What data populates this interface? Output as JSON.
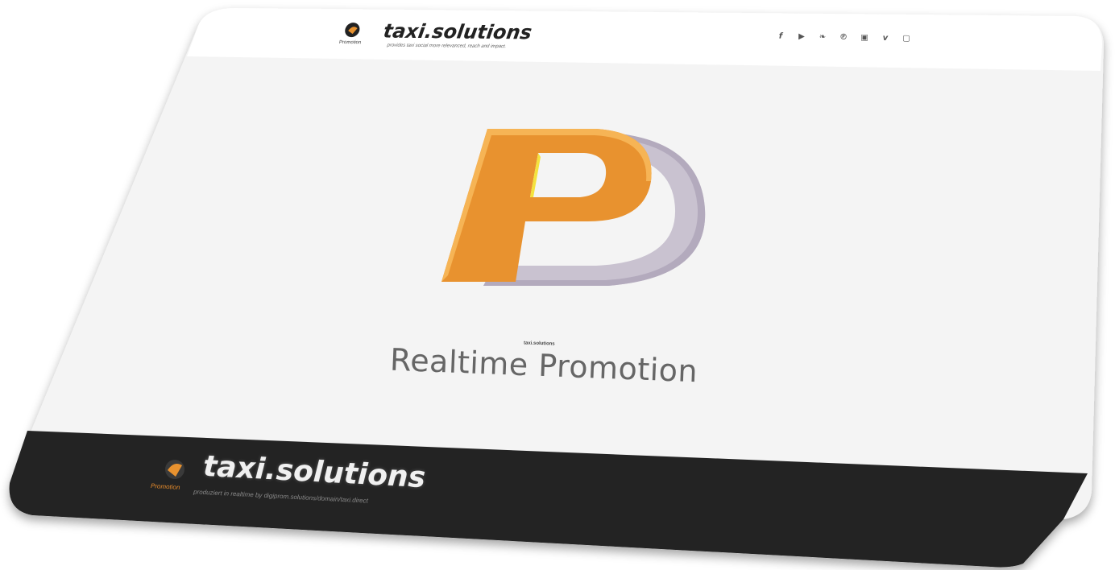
{
  "header": {
    "brand_title": "taxi.solutions",
    "brand_badge": "Promotion",
    "brand_tagline": "provides taxi social more relevanced, reach and impact.",
    "social_icons": [
      {
        "name": "facebook-icon",
        "glyph": "f"
      },
      {
        "name": "youtube-icon",
        "glyph": "▶"
      },
      {
        "name": "twitter-icon",
        "glyph": "❧"
      },
      {
        "name": "pinterest-icon",
        "glyph": "℗"
      },
      {
        "name": "stumbleupon-icon",
        "glyph": "▣"
      },
      {
        "name": "vimeo-icon",
        "glyph": "v"
      },
      {
        "name": "twitch-icon",
        "glyph": "▢"
      }
    ]
  },
  "hero": {
    "small_label": "taxi.solutions",
    "title": "Realtime Promotion"
  },
  "footer": {
    "brand_badge": "Promotion",
    "brand_title": "taxi.solutions",
    "tagline": "produziert in realtime by digiprom.solutions/domain/taxi.direct"
  },
  "colors": {
    "accent_orange": "#e8922f",
    "logo_lilac": "#c9c2d0",
    "footer_bg": "#232323",
    "page_bg": "#f4f4f4"
  }
}
